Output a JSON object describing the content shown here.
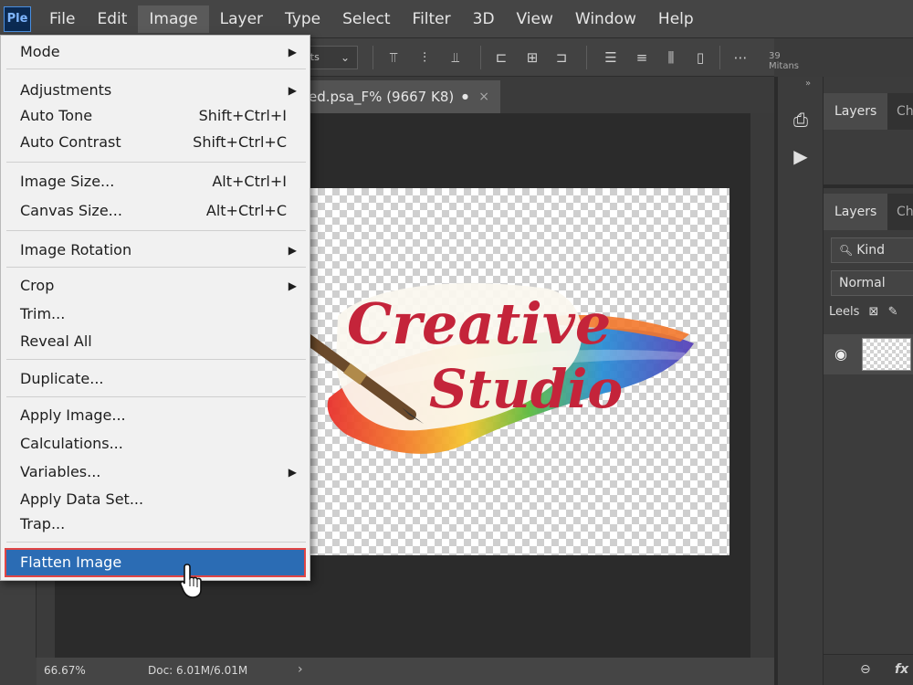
{
  "menubar": {
    "logo": "Ple",
    "items": [
      "File",
      "Edit",
      "Image",
      "Layer",
      "Type",
      "Select",
      "Filter",
      "3D",
      "View",
      "Window",
      "Help"
    ],
    "active": "Image"
  },
  "optionsbar": {
    "select_text": "ets",
    "right_text": "39 Mitans"
  },
  "document_tab": {
    "title": "ed.psa_F% (9667 K8)",
    "modified_marker": "●",
    "close": "×"
  },
  "canvas": {
    "artwork_text_line1": "Creative",
    "artwork_text_line2": "Studio"
  },
  "statusbar": {
    "zoom": "66.67%",
    "doc_info": "Doc: 6.01M/6.01M",
    "arrow": "›"
  },
  "panels": {
    "collapse_glyph": "»",
    "top_group": {
      "tab_active": "Layers",
      "tab_other": "Ch"
    },
    "layers_group": {
      "tab_active": "Layers",
      "tab_other": "Ch"
    },
    "filter_kind": "Kind",
    "blend_mode": "Normal",
    "lock_label": "Leels",
    "bottom_icons": [
      "link-icon",
      "fx-icon"
    ],
    "fx_label": "fx"
  },
  "image_menu": {
    "items": [
      {
        "label": "Mode",
        "submenu": true
      },
      {
        "label": "Adjustments",
        "submenu": true
      },
      {
        "label": "Auto Tone",
        "shortcut": "Shift+Ctrl+I"
      },
      {
        "label": "Auto Contrast",
        "shortcut": "Shift+Ctrl+C"
      },
      {
        "label": "Image Size...",
        "shortcut": "Alt+Ctrl+I"
      },
      {
        "label": "Canvas Size...",
        "shortcut": "Alt+Ctrl+C"
      },
      {
        "label": "Image Rotation",
        "submenu": true
      },
      {
        "label": "Crop",
        "submenu": true
      },
      {
        "label": "Trim..."
      },
      {
        "label": "Reveal All"
      },
      {
        "label": "Duplicate..."
      },
      {
        "label": "Apply Image..."
      },
      {
        "label": "Calculations..."
      },
      {
        "label": "Variables...",
        "submenu": true
      },
      {
        "label": "Apply Data Set..."
      },
      {
        "label": "Trap..."
      },
      {
        "label": "Flatten Image",
        "selected": true
      }
    ],
    "submenu_glyph": "▶"
  },
  "colors": {
    "selected_highlight": "#2b6cb4",
    "selection_outline": "#e04545",
    "artwork_red": "#c4243a"
  }
}
